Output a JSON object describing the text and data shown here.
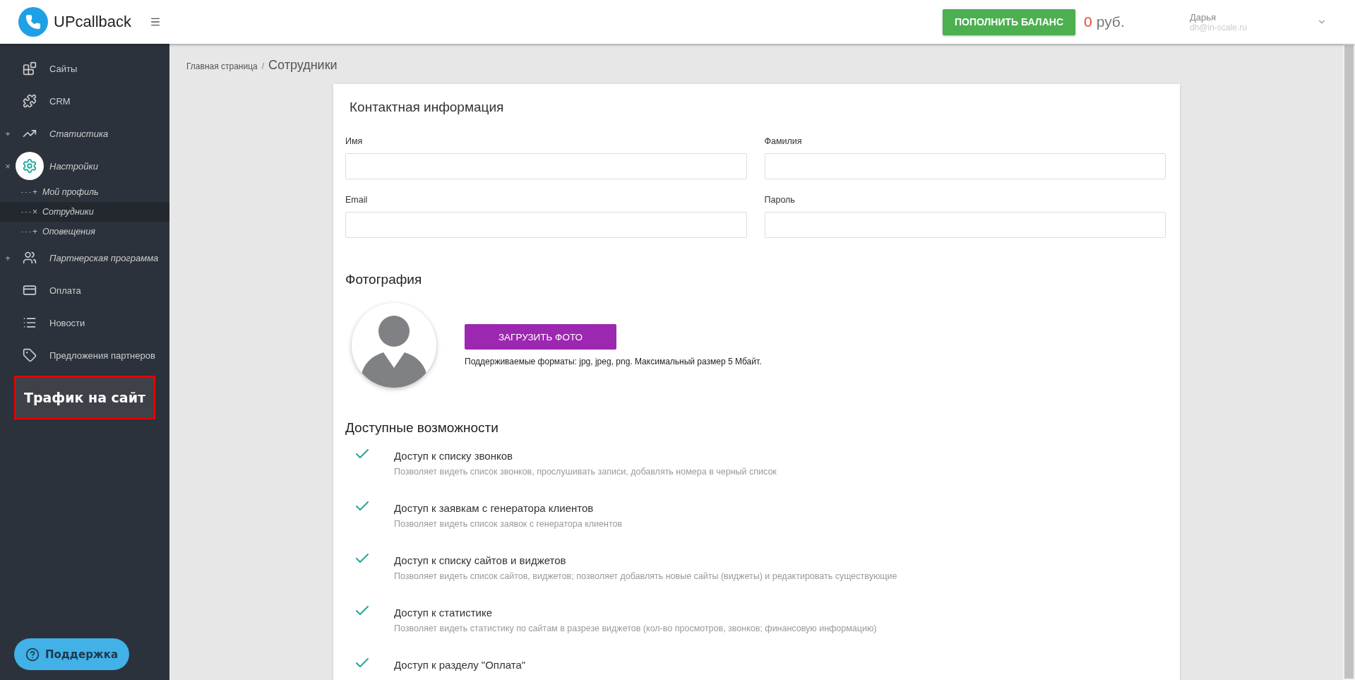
{
  "header": {
    "logo": "UPcallback",
    "topup_button": "ПОПОЛНИТЬ БАЛАНС",
    "balance": "0",
    "currency": "руб.",
    "user": {
      "name": "Дарья",
      "email": "dh@in-scale.ru"
    }
  },
  "sidebar": {
    "items": [
      {
        "label": "Сайты",
        "marker": "",
        "selected": false
      },
      {
        "label": "CRM",
        "marker": "",
        "selected": false
      },
      {
        "label": "Статистика",
        "marker": "+",
        "selected": false
      },
      {
        "label": "Настройки",
        "marker": "×",
        "selected": true,
        "children": [
          {
            "label": "Мой профиль",
            "marker": "+",
            "selected": false
          },
          {
            "label": "Сотрудники",
            "marker": "×",
            "selected": true
          },
          {
            "label": "Оповещения",
            "marker": "+",
            "selected": false
          }
        ]
      },
      {
        "label": "Партнерская программа",
        "marker": "+",
        "selected": false
      },
      {
        "label": "Оплата",
        "marker": "",
        "selected": false
      },
      {
        "label": "Новости",
        "marker": "",
        "selected": false
      },
      {
        "label": "Предложения партнеров",
        "marker": "",
        "selected": false
      }
    ],
    "banner": "Трафик на сайт",
    "support_button": "Поддержка"
  },
  "breadcrumb": {
    "home": "Главная страница",
    "separator": "/",
    "current": "Сотрудники"
  },
  "contact": {
    "title": "Контактная информация",
    "fields": [
      {
        "label": "Имя"
      },
      {
        "label": "Фамилия"
      },
      {
        "label": "Email"
      },
      {
        "label": "Пароль"
      }
    ]
  },
  "photo": {
    "title": "Фотография",
    "upload_button": "ЗАГРУЗИТЬ ФОТО",
    "hint": "Поддерживаемые форматы: jpg, jpeg, png. Максимальный размер 5 Мбайт."
  },
  "features": {
    "title": "Доступные возможности",
    "items": [
      {
        "title": "Доступ к списку звонков",
        "description": "Позволяет видеть список звонков, прослушивать записи, добавлять номера в черный список",
        "checked": true
      },
      {
        "title": "Доступ к заявкам с генератора клиентов",
        "description": "Позволяет видеть список заявок с генератора клиентов",
        "checked": true
      },
      {
        "title": "Доступ к списку сайтов и виджетов",
        "description": "Позволяет видеть список сайтов, виджетов; позволяет добавлять новые сайты (виджеты) и редактировать существующие",
        "checked": true
      },
      {
        "title": "Доступ к статистике",
        "description": "Позволяет видеть статистику по сайтам в разрезе виджетов (кол-во просмотров, звонков; финансовую информацию)",
        "checked": true
      },
      {
        "title": "Доступ к разделу \"Оплата\"",
        "checked": true
      }
    ]
  }
}
